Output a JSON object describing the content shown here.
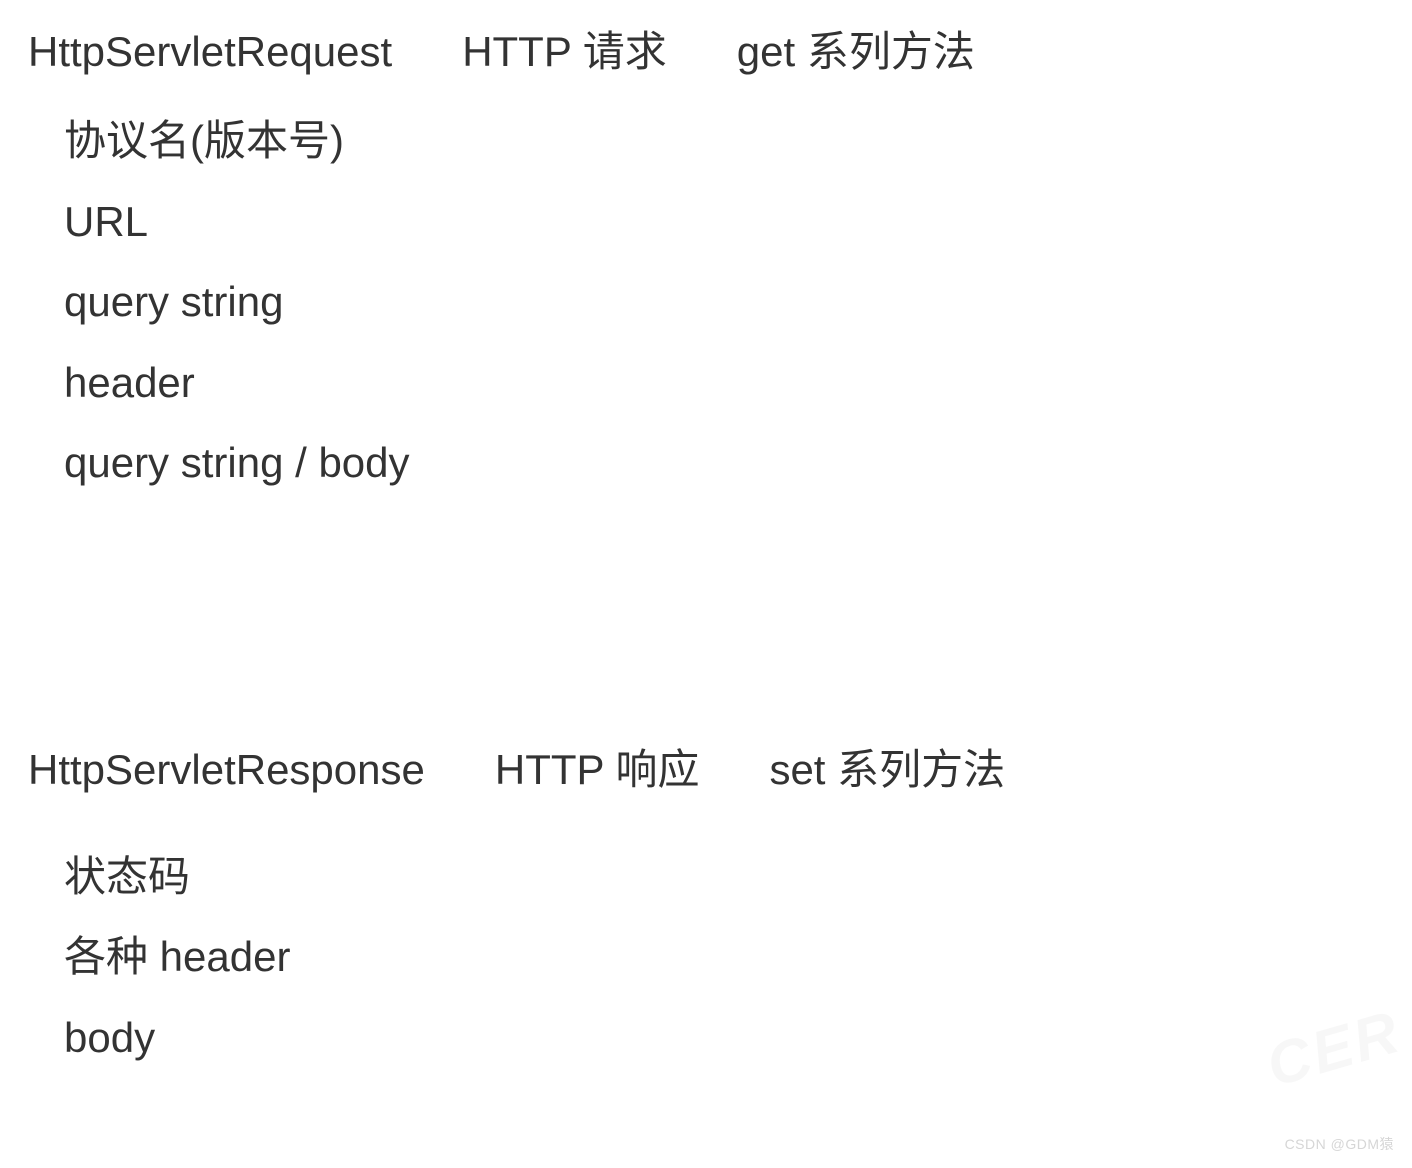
{
  "request": {
    "heading": {
      "class_name": "HttpServletRequest",
      "type": "HTTP 请求",
      "methods": "get 系列方法"
    },
    "items": [
      "协议名(版本号)",
      "URL",
      "query string",
      "header",
      "query string  /  body"
    ]
  },
  "response": {
    "heading": {
      "class_name": "HttpServletResponse",
      "type": "HTTP 响应",
      "methods": "set 系列方法"
    },
    "items": [
      "状态码",
      "各种 header",
      "body"
    ]
  },
  "watermark": "CSDN @GDM猿"
}
